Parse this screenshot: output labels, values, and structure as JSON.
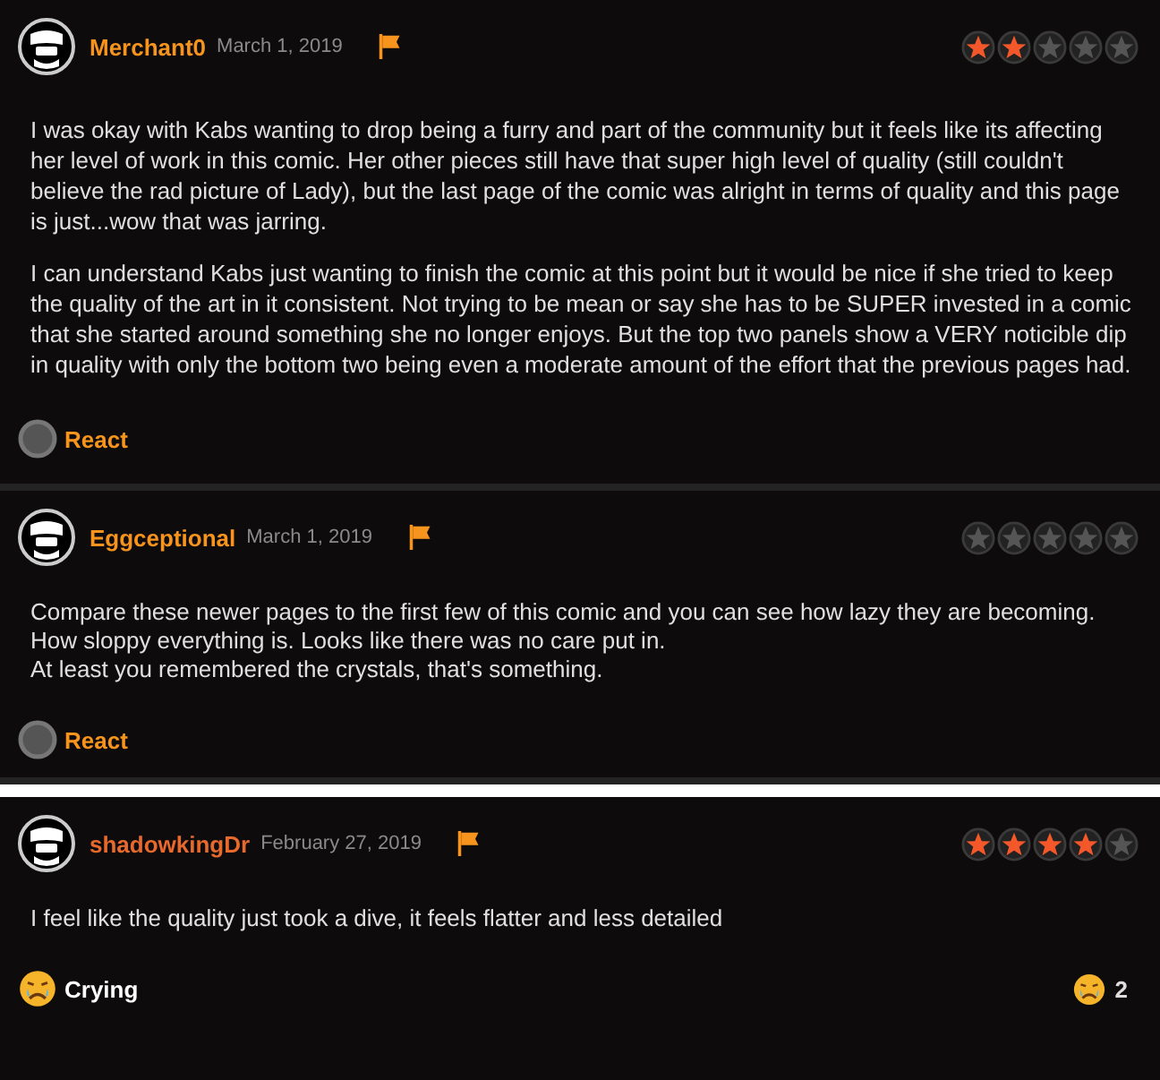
{
  "comments": [
    {
      "user": {
        "name": "Merchant0",
        "color": "#f7941d"
      },
      "date": "March 1, 2019",
      "stars": 2,
      "paragraphs": [
        "I was okay with Kabs wanting to drop being a furry and part of the community but it feels like its affecting her level of work in this comic. Her other pieces still have that super high level of quality (still couldn't believe the rad picture of Lady), but the last page of the comic was alright in terms of quality and this page is just...wow that was jarring.",
        "I can understand Kabs just wanting to finish the comic at this point but it would be nice if she tried to keep the quality of the art in it consistent. Not trying to be mean or say she has to be SUPER invested in a comic that she started around something she no longer enjoys. But the top two panels show a VERY noticible dip in quality with only the bottom two being even a moderate amount of the effort that the previous pages had."
      ],
      "reaction": {
        "kind": "none",
        "label": "React"
      }
    },
    {
      "user": {
        "name": "Eggceptional",
        "color": "#f7941d"
      },
      "date": "March 1, 2019",
      "stars": 0,
      "paragraphs": [
        "Compare these newer pages to the first few of this comic and you can see how lazy they are becoming. How sloppy everything is. Looks like there was no care put in.\nAt least you remembered the crystals, that's something."
      ],
      "reaction": {
        "kind": "none",
        "label": "React"
      }
    },
    {
      "user": {
        "name": "shadowkingDr",
        "color": "#e8692c"
      },
      "date": "February 27, 2019",
      "stars": 4,
      "paragraphs": [
        "I feel like the quality just took a dive, it feels flatter and less detailed"
      ],
      "reaction": {
        "kind": "crying",
        "label": "Crying"
      },
      "reaction_count": "2"
    }
  ]
}
